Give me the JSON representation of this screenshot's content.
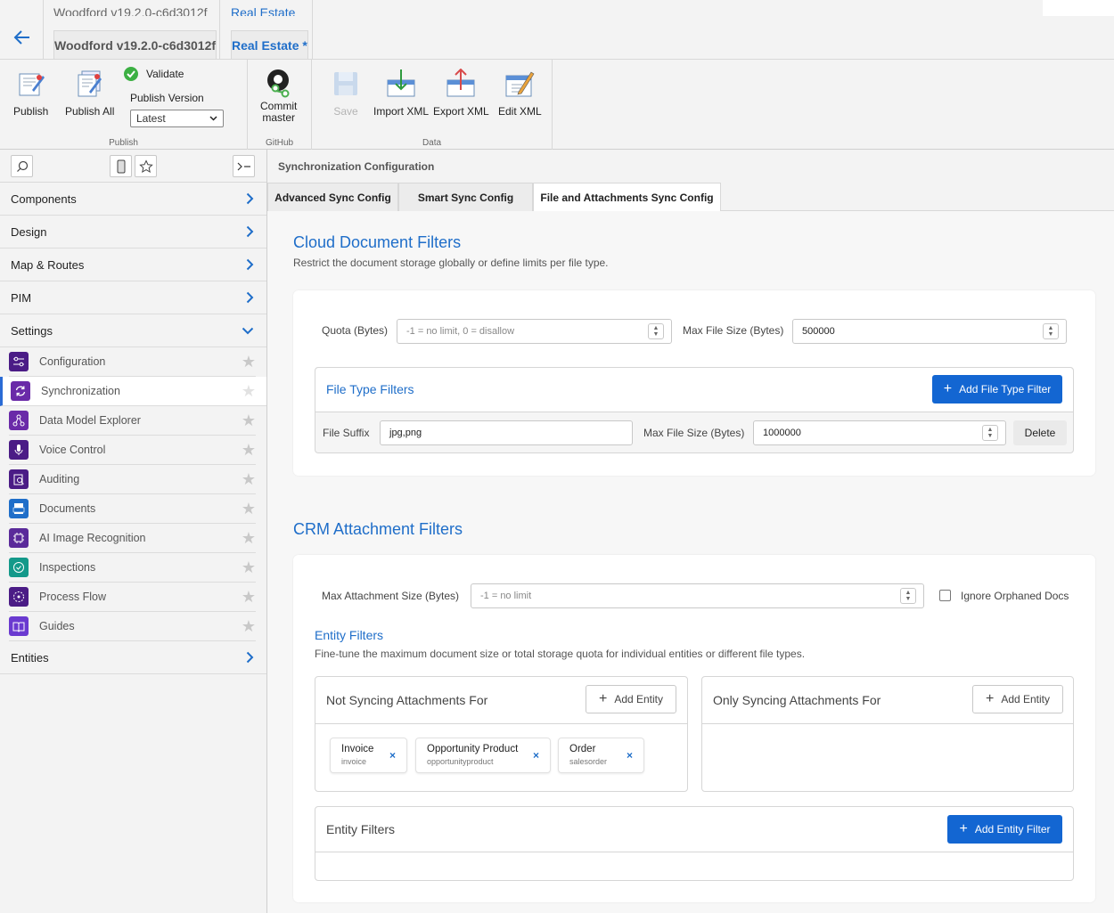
{
  "title_bar": {
    "back_label": "Back",
    "project": "Woodford v19.2.0-c6d3012f",
    "solution": "Real Estate *",
    "ghost_project": "Woodford v19.2.0-c6d3012f",
    "ghost_solution": "Real Estate"
  },
  "ribbon": {
    "publish_group": {
      "caption": "Publish",
      "publish": "Publish",
      "publish_all": "Publish All",
      "validate": "Validate",
      "publish_version_label": "Publish Version",
      "publish_version_value": "Latest"
    },
    "github_group": {
      "caption": "GitHub",
      "commit_line1": "Commit",
      "commit_line2": "master"
    },
    "data_group": {
      "caption": "Data",
      "save": "Save",
      "import_xml": "Import XML",
      "export_xml": "Export XML",
      "edit_xml": "Edit XML"
    }
  },
  "sidebar": {
    "sections": {
      "components": "Components",
      "design": "Design",
      "map_routes": "Map & Routes",
      "pim": "PIM",
      "settings": "Settings",
      "entities": "Entities"
    },
    "settings_items": [
      {
        "label": "Configuration",
        "icon": "sliders-icon",
        "color": "#4b1c86"
      },
      {
        "label": "Synchronization",
        "icon": "sync-icon",
        "color": "#6a2aa8"
      },
      {
        "label": "Data Model Explorer",
        "icon": "graph-icon",
        "color": "#6a2aa8"
      },
      {
        "label": "Voice Control",
        "icon": "microphone-icon",
        "color": "#4b1c86"
      },
      {
        "label": "Auditing",
        "icon": "audit-icon",
        "color": "#4b1c86"
      },
      {
        "label": "Documents",
        "icon": "document-icon",
        "color": "#1f6ec9"
      },
      {
        "label": "AI Image Recognition",
        "icon": "ai-chip-icon",
        "color": "#5a2a9a"
      },
      {
        "label": "Inspections",
        "icon": "check-circle-icon",
        "color": "#14998a"
      },
      {
        "label": "Process Flow",
        "icon": "process-flow-icon",
        "color": "#4b1c86"
      },
      {
        "label": "Guides",
        "icon": "book-icon",
        "color": "#6a3ad0"
      }
    ]
  },
  "main": {
    "header": "Synchronization Configuration",
    "tabs": [
      "Advanced Sync Config",
      "Smart Sync Config",
      "File and Attachments Sync Config"
    ],
    "cloud": {
      "title": "Cloud Document Filters",
      "subtitle": "Restrict the document storage globally or define limits per file type.",
      "quota_label": "Quota (Bytes)",
      "quota_placeholder": "-1 = no limit, 0 = disallow",
      "max_size_label": "Max File Size (Bytes)",
      "max_size_value": "500000",
      "file_type_filters_title": "File Type Filters",
      "add_file_type_filter": "Add File Type Filter",
      "row": {
        "suffix_label": "File Suffix",
        "suffix_value": "jpg,png",
        "max_size_label": "Max File Size (Bytes)",
        "max_size_value": "1000000",
        "delete": "Delete"
      }
    },
    "crm": {
      "title": "CRM Attachment Filters",
      "max_attach_label": "Max Attachment Size (Bytes)",
      "max_attach_placeholder": "-1 = no limit",
      "ignore_orphaned": "Ignore Orphaned Docs",
      "entity_filters_title": "Entity Filters",
      "entity_filters_sub": "Fine-tune the maximum document size or total storage quota for individual entities or different file types.",
      "not_syncing_title": "Not Syncing Attachments For",
      "only_syncing_title": "Only Syncing Attachments For",
      "add_entity": "Add Entity",
      "chips": [
        {
          "name": "Invoice",
          "logical": "invoice"
        },
        {
          "name": "Opportunity Product",
          "logical": "opportunityproduct"
        },
        {
          "name": "Order",
          "logical": "salesorder"
        }
      ],
      "entity_filters_box_title": "Entity Filters",
      "add_entity_filter": "Add Entity Filter"
    }
  }
}
